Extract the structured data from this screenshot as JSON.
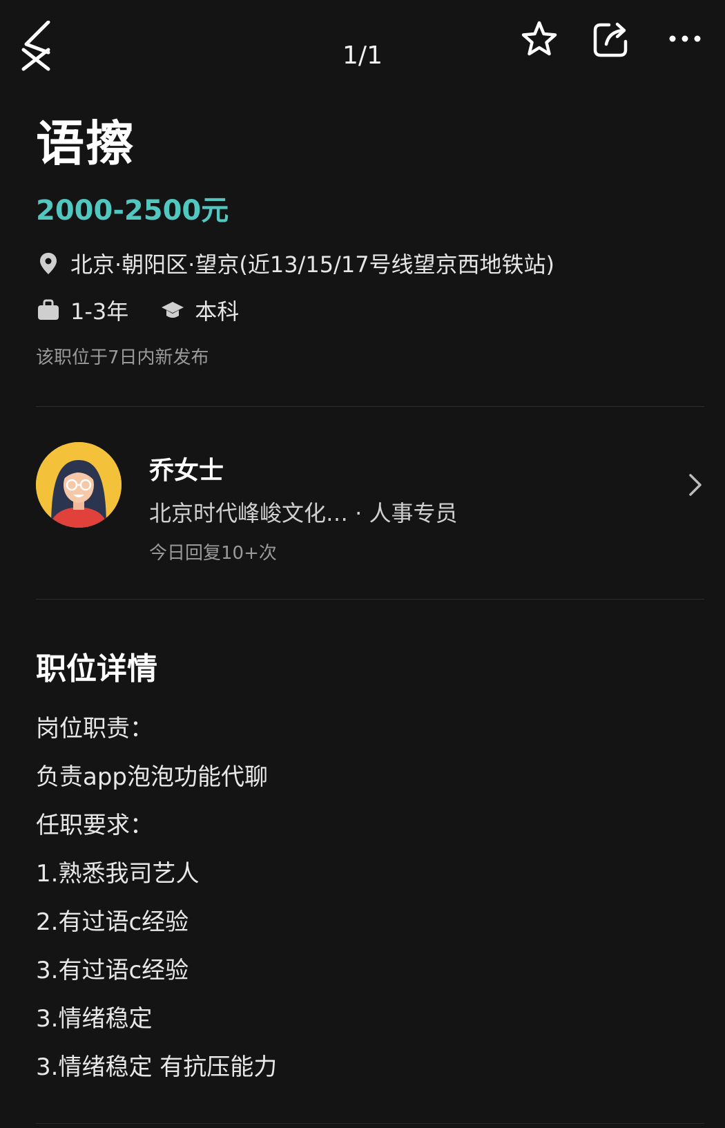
{
  "top_bar": {
    "page_indicator": "1/1"
  },
  "job": {
    "title": "语擦",
    "salary": "2000-2500元",
    "location": "北京·朝阳区·望京(近13/15/17号线望京西地铁站)",
    "experience": "1-3年",
    "education": "本科",
    "posted": "该职位于7日内新发布"
  },
  "recruiter": {
    "name": "乔女士",
    "company": "北京时代峰峻文化… · 人事专员",
    "reply_rate": "今日回复10+次"
  },
  "details": {
    "title": "职位详情",
    "lines": [
      "岗位职责：",
      "负责app泡泡功能代聊",
      "任职要求：",
      "1.熟悉我司艺人",
      "2.有过语c经验",
      "3.有过语c经验",
      "3.情绪稳定",
      "3.情绪稳定 有抗压能力"
    ]
  },
  "colors": {
    "background": "#141414",
    "salary": "#52c7c0",
    "avatar_bg": "#f3c23a"
  },
  "icons": [
    "close-icon",
    "star-icon",
    "share-icon",
    "more-icon",
    "location-pin-icon",
    "briefcase-icon",
    "graduation-cap-icon",
    "chevron-right-icon"
  ]
}
